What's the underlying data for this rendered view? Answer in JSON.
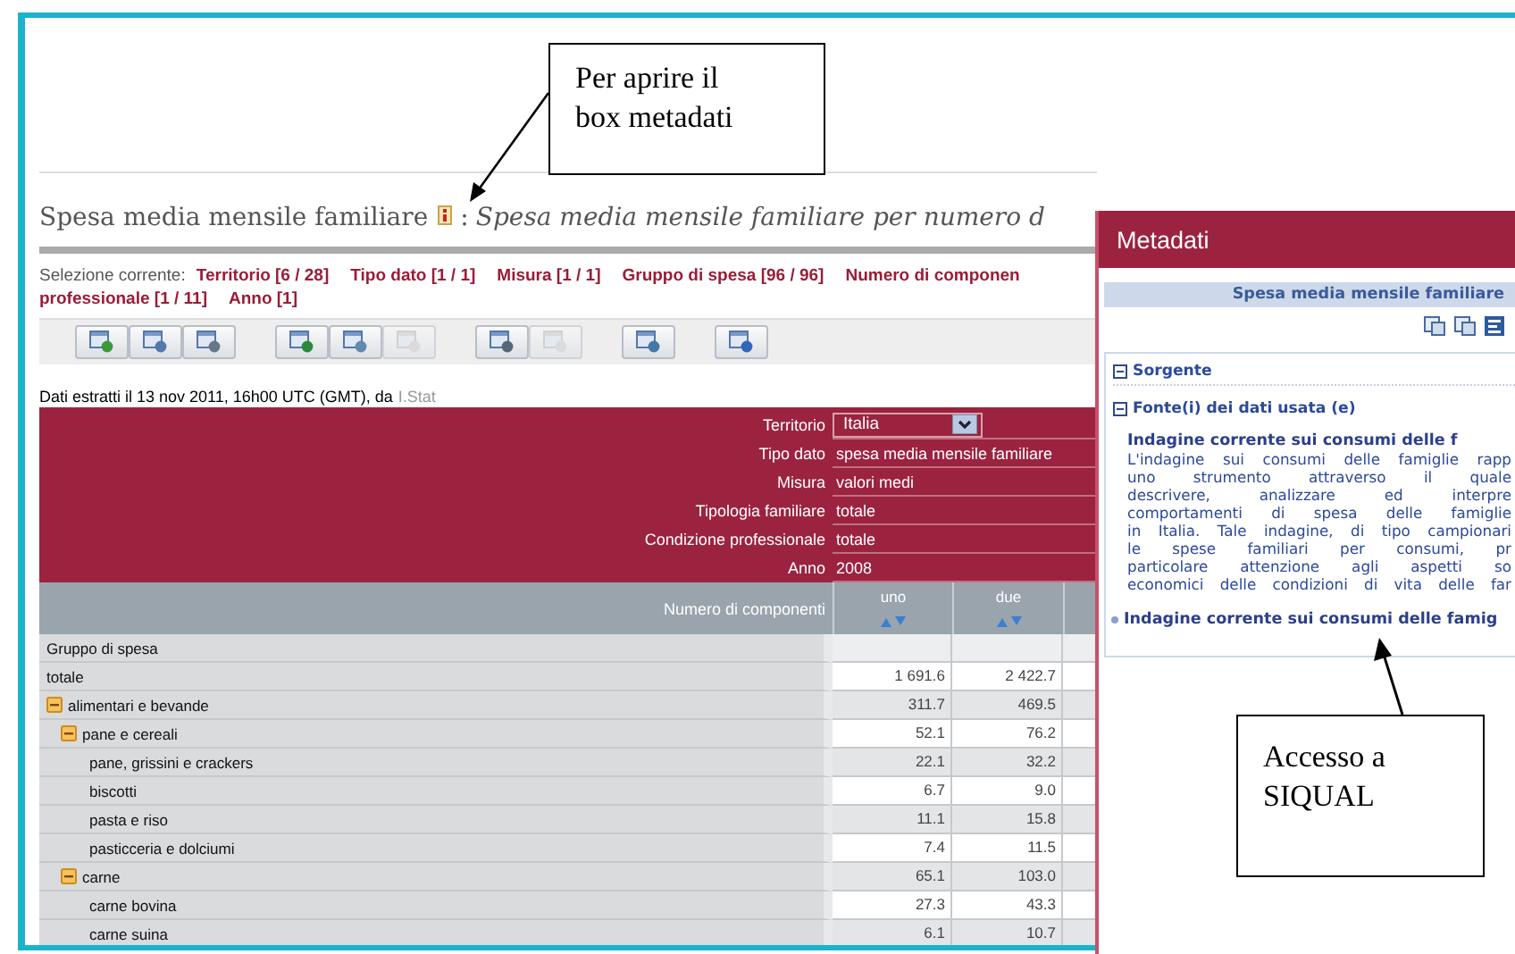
{
  "callouts": [
    {
      "lines": [
        "Per aprire il",
        "box metadati"
      ]
    },
    {
      "lines": [
        "Accesso a",
        "SIQUAL"
      ]
    }
  ],
  "title": {
    "main": "Spesa media mensile familiare",
    "separator": ":",
    "subtitle": "Spesa media mensile familiare per numero d"
  },
  "selection": {
    "label": "Selezione corrente:",
    "lines": [
      [
        "Territorio [6 / 28]",
        "Tipo dato [1 / 1]",
        "Misura [1 / 1]",
        "Gruppo di spesa [96 / 96]",
        "Numero di componen"
      ],
      [
        "professionale [1 / 11]",
        "Anno [1]"
      ]
    ]
  },
  "toolbar": {
    "groups": [
      [
        {
          "disabled": false
        },
        {
          "disabled": false
        },
        {
          "disabled": false
        }
      ],
      [
        {
          "disabled": false
        },
        {
          "disabled": false
        },
        {
          "disabled": true
        }
      ],
      [
        {
          "disabled": false
        },
        {
          "disabled": true
        }
      ],
      [
        {
          "disabled": false
        }
      ],
      [
        {
          "disabled": false
        }
      ]
    ]
  },
  "extraction": {
    "text": "Dati estratti il 13 nov 2011, 16h00 UTC (GMT), da",
    "link": "I.Stat"
  },
  "table": {
    "filters": [
      {
        "label": "Territorio",
        "value": "Italia",
        "kind": "select"
      },
      {
        "label": "Tipo dato",
        "value": "spesa media mensile familiare",
        "kind": "text"
      },
      {
        "label": "Misura",
        "value": "valori medi",
        "kind": "text"
      },
      {
        "label": "Tipologia familiare",
        "value": "totale",
        "kind": "text"
      },
      {
        "label": "Condizione professionale",
        "value": "totale",
        "kind": "text"
      },
      {
        "label": "Anno",
        "value": "2008",
        "kind": "text"
      }
    ],
    "column_group": "Numero di componenti",
    "columns": [
      "uno",
      "due"
    ],
    "row_header": "Gruppo di spesa",
    "rows": [
      {
        "label": "totale",
        "values": [
          "1 691.6",
          "2 422.7"
        ]
      },
      {
        "label": "alimentari e bevande",
        "values": [
          "311.7",
          "469.5"
        ],
        "expanded": true,
        "children": [
          {
            "label": "pane e cereali",
            "values": [
              "52.1",
              "76.2"
            ],
            "expanded": true,
            "children": [
              {
                "label": "pane, grissini e crackers",
                "values": [
                  "22.1",
                  "32.2"
                ]
              },
              {
                "label": "biscotti",
                "values": [
                  "6.7",
                  "9.0"
                ]
              },
              {
                "label": "pasta e riso",
                "values": [
                  "11.1",
                  "15.8"
                ]
              },
              {
                "label": "pasticceria e dolciumi",
                "values": [
                  "7.4",
                  "11.5"
                ]
              }
            ]
          },
          {
            "label": "carne",
            "values": [
              "65.1",
              "103.0"
            ],
            "expanded": true,
            "children": [
              {
                "label": "carne bovina",
                "values": [
                  "27.3",
                  "43.3"
                ]
              },
              {
                "label": "carne suina",
                "values": [
                  "6.1",
                  "10.7"
                ]
              }
            ]
          }
        ]
      }
    ]
  },
  "metadata_panel": {
    "title": "Metadati",
    "dataset": "Spesa media mensile familiare",
    "section": {
      "title": "Sorgente",
      "expanded": true
    },
    "subsection": {
      "title": "Fonte(i) dei dati usata (e)",
      "expanded": true
    },
    "heading": "Indagine corrente sui consumi delle f",
    "lines": [
      "L'indagine sui consumi delle famiglie rapp",
      "uno strumento attraverso il quale",
      "descrivere, analizzare ed interpre",
      "comportamenti di spesa delle famiglie",
      "in Italia. Tale indagine, di tipo campionari",
      "le spese familiari per consumi, pr",
      "particolare attenzione agli aspetti so",
      "economici delle condizioni di vita delle far"
    ],
    "link": "Indagine corrente sui consumi delle famig"
  }
}
